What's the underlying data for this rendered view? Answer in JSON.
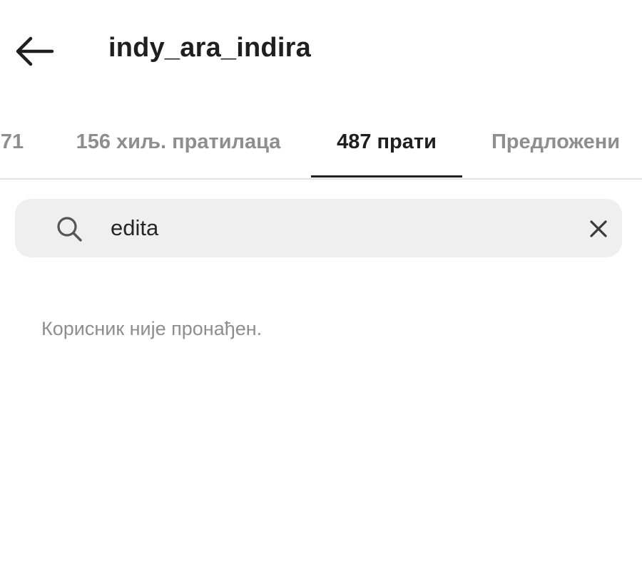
{
  "header": {
    "title": "indy_ara_indira",
    "back_icon": "arrow-left-icon"
  },
  "tabs": [
    {
      "label": "71",
      "active": false
    },
    {
      "label": "156 хиљ. пратилаца",
      "active": false
    },
    {
      "label": "487 прати",
      "active": true
    },
    {
      "label": "Предложени",
      "active": false
    }
  ],
  "search": {
    "icon": "search-icon",
    "value": "edita",
    "clear_icon": "close-icon"
  },
  "results": {
    "empty_message": "Корисник није пронађен."
  },
  "colors": {
    "background": "#ffffff",
    "text_primary": "#1f1f1f",
    "text_secondary": "#8e8e8e",
    "search_bg": "#efefef",
    "divider": "#e3e3e3"
  }
}
